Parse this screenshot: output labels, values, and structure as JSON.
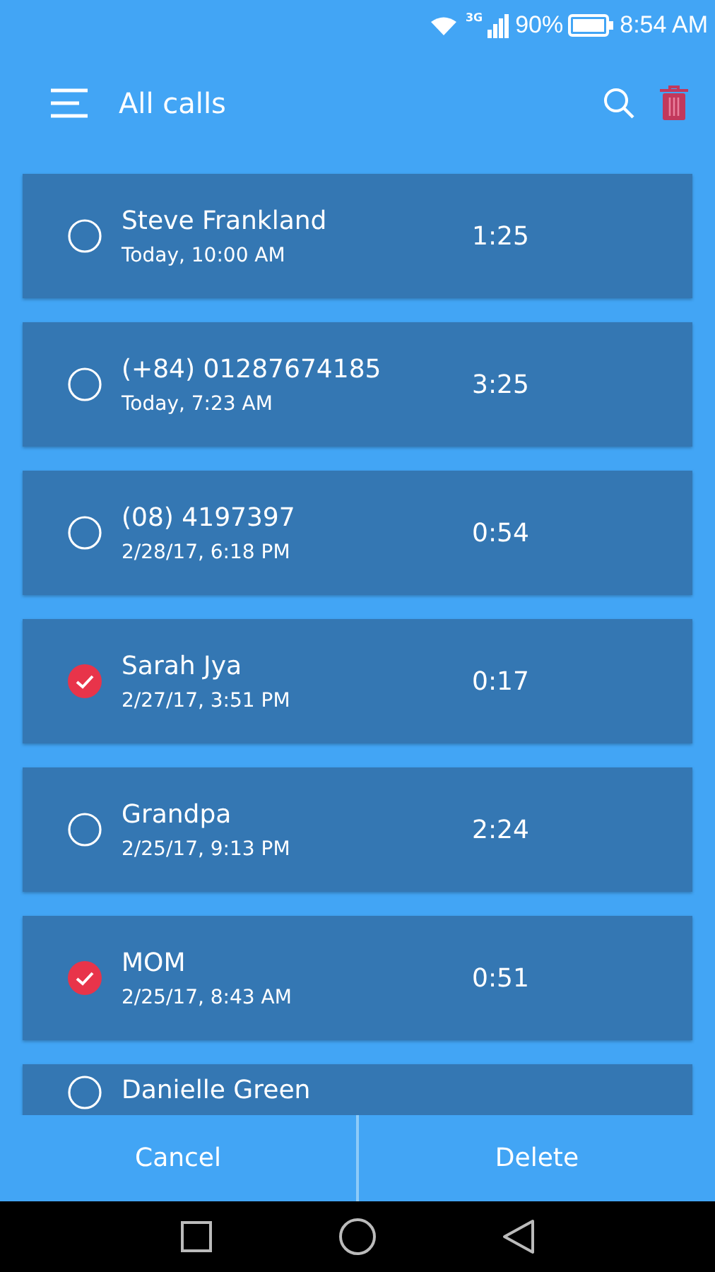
{
  "status_bar": {
    "network": "3G",
    "battery": "90%",
    "time": "8:54 AM"
  },
  "header": {
    "title": "All calls"
  },
  "calls": [
    {
      "name": "Steve Frankland",
      "time": "Today, 10:00 AM",
      "duration": "1:25",
      "selected": false
    },
    {
      "name": "(+84) 01287674185",
      "time": "Today, 7:23 AM",
      "duration": "3:25",
      "selected": false
    },
    {
      "name": "(08) 4197397",
      "time": "2/28/17, 6:18 PM",
      "duration": "0:54",
      "selected": false
    },
    {
      "name": "Sarah Jya",
      "time": "2/27/17, 3:51 PM",
      "duration": "0:17",
      "selected": true
    },
    {
      "name": "Grandpa",
      "time": "2/25/17, 9:13 PM",
      "duration": "2:24",
      "selected": false
    },
    {
      "name": "MOM",
      "time": "2/25/17, 8:43 AM",
      "duration": "0:51",
      "selected": true
    },
    {
      "name": "Danielle Green",
      "selected": false
    }
  ],
  "actions": [
    "Cancel",
    "Delete"
  ]
}
